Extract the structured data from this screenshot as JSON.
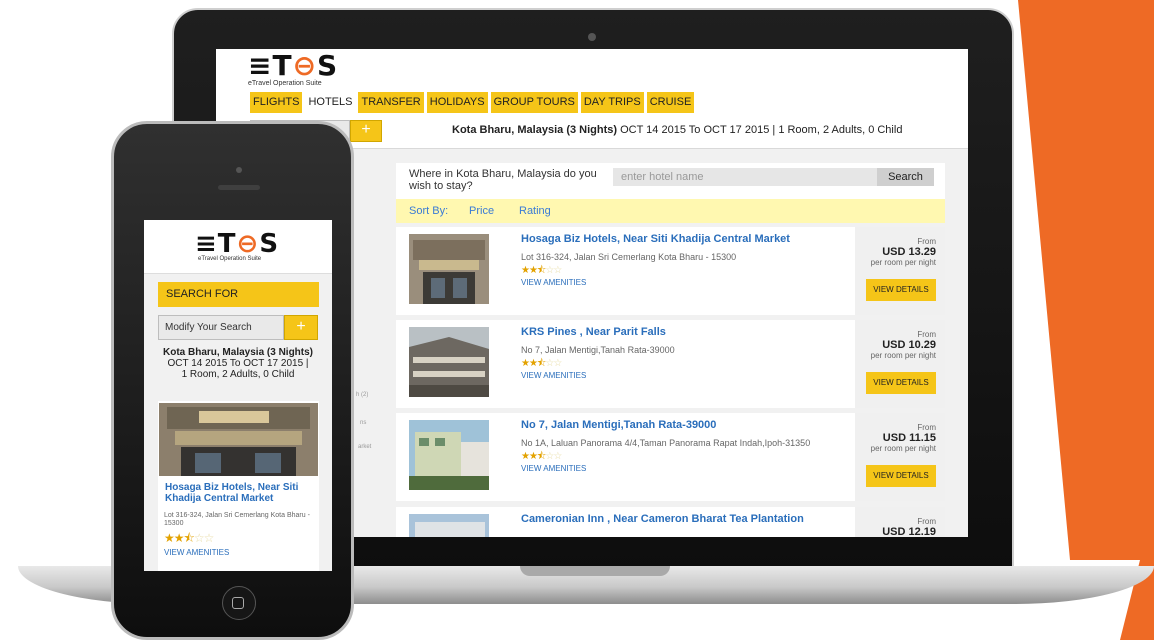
{
  "brand": {
    "logo_text_pre": "≡T",
    "logo_text_o": "⊖",
    "logo_text_post": "S",
    "tagline": "eTravel Operation Suite",
    "accent_color": "#ee6a25",
    "highlight_color": "#f5c518"
  },
  "nav": {
    "tabs": [
      "FLIGHTS",
      "HOTELS",
      "TRANSFER",
      "HOLIDAYS",
      "GROUP TOURS",
      "DAY TRIPS",
      "CRUISE"
    ],
    "active_tab": "HOTELS"
  },
  "search": {
    "modify_label": "Modify Your Search",
    "plus_icon": "+",
    "destination": "Kota Bharu, Malaysia (3 Nights)",
    "dates": "OCT 14 2015 To OCT 17 2015",
    "separator": "|",
    "occupancy": "1 Room, 2 Adults, 0 Child",
    "where_question": "Where in Kota Bharu, Malaysia do you wish to stay?",
    "hotel_placeholder": "enter hotel name",
    "search_button": "Search"
  },
  "sort": {
    "label": "Sort By:",
    "options": [
      "Price",
      "Rating"
    ]
  },
  "hotels": [
    {
      "name": "Hosaga Biz Hotels, Near Siti Khadija Central Market",
      "address": "Lot 316-324, Jalan Sri Cemerlang Kota Bharu - 15300",
      "stars_filled": "★★⯪",
      "stars_empty": "☆☆",
      "amenities": "VIEW AMENITIES",
      "from": "From",
      "price": "USD 13.29",
      "per": "per room per night",
      "cta": "VIEW DETAILS"
    },
    {
      "name": "KRS Pines , Near Parit Falls",
      "address": "No 7, Jalan Mentigi,Tanah Rata-39000",
      "stars_filled": "★★⯪",
      "stars_empty": "☆☆",
      "amenities": "VIEW AMENITIES",
      "from": "From",
      "price": "USD 10.29",
      "per": "per room per night",
      "cta": "VIEW DETAILS"
    },
    {
      "name": "No 7, Jalan Mentigi,Tanah Rata-39000",
      "address": "No 1A, Laluan Panorama 4/4,Taman Panorama Rapat Indah,Ipoh-31350",
      "stars_filled": "★★⯪",
      "stars_empty": "☆☆",
      "amenities": "VIEW AMENITIES",
      "from": "From",
      "price": "USD 11.15",
      "per": "per room per night",
      "cta": "VIEW DETAILS"
    },
    {
      "name": "Cameronian Inn , Near Cameron Bharat Tea Plantation",
      "address": "",
      "stars_filled": "",
      "stars_empty": "",
      "amenities": "",
      "from": "From",
      "price": "USD 12.19",
      "per": "",
      "cta": ""
    }
  ],
  "mobile": {
    "search_for": "SEARCH FOR",
    "modify_label": "Modify Your Search",
    "plus_icon": "+",
    "destination": "Kota Bharu, Malaysia (3 Nights)",
    "dates_line": "OCT 14 2015 To OCT 17 2015  |",
    "occupancy": "1 Room, 2 Adults, 0 Child",
    "hotel_name": "Hosaga Biz Hotels, Near Siti Khadija Central Market",
    "hotel_address": "Lot 316-324, Jalan Sri Cemerlang Kota Bharu - 15300",
    "stars_filled": "★★⯪",
    "stars_empty": "☆☆",
    "amenities": "VIEW AMENITIES"
  },
  "sidebar_fragments": [
    "h (2)",
    "ns",
    "arket"
  ]
}
